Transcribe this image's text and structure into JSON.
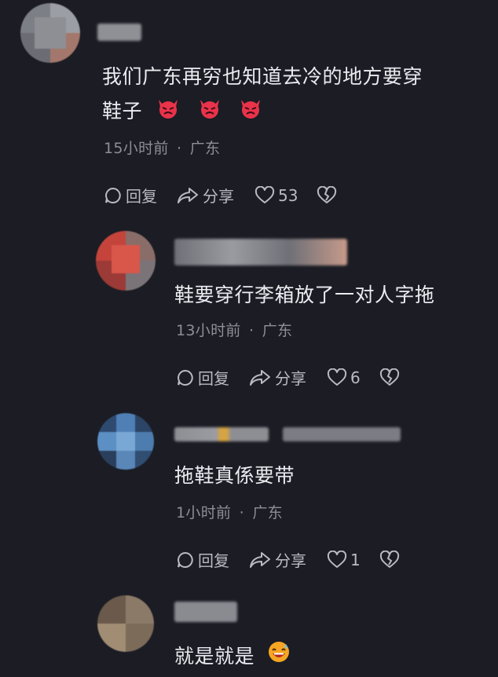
{
  "comments": [
    {
      "text_line1": "我们广东再穷也知道去冷的地方要穿",
      "text_line2": "鞋子",
      "emoji_icon": "angry-devil-emoji",
      "time": "15小时前",
      "location": "广东",
      "reply_label": "回复",
      "share_label": "分享",
      "like_count": "53"
    },
    {
      "text": "鞋要穿行李箱放了一对人字拖",
      "time": "13小时前",
      "location": "广东",
      "reply_label": "回复",
      "share_label": "分享",
      "like_count": "6"
    },
    {
      "text": "拖鞋真係要带",
      "time": "1小时前",
      "location": "广东",
      "reply_label": "回复",
      "share_label": "分享",
      "like_count": "1"
    },
    {
      "text": "就是就是",
      "emoji_icon": "grinning-sweat-emoji"
    }
  ],
  "separator": "·",
  "colors": {
    "background": "#1b1c24",
    "text": "#ebebf0",
    "meta": "#8d8e98",
    "action": "#b9bac3",
    "emoji_red": "#e8334a",
    "emoji_yellow": "#f6a623"
  }
}
